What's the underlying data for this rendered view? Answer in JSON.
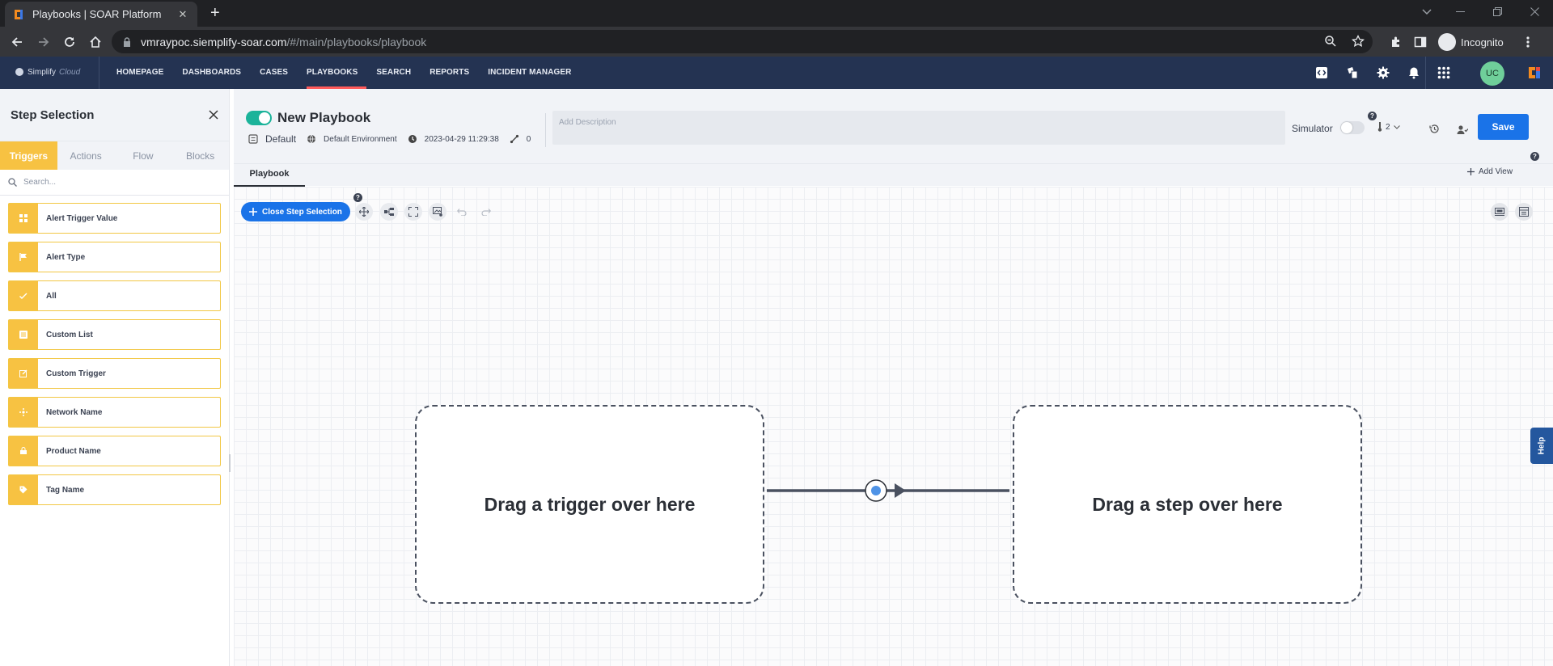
{
  "browser": {
    "tab_title": "Playbooks | SOAR Platform",
    "new_tab_icon": "plus-icon",
    "url_host": "vmraypoc.siemplify-soar.com",
    "url_path": "/#/main/playbooks/playbook",
    "profile_label": "Incognito"
  },
  "app": {
    "logo_text": "Simplify",
    "logo_suffix": "Cloud",
    "nav": [
      "HOMEPAGE",
      "DASHBOARDS",
      "CASES",
      "PLAYBOOKS",
      "SEARCH",
      "REPORTS",
      "INCIDENT MANAGER"
    ],
    "active_nav": "PLAYBOOKS",
    "accent_color": "#ff5b5b",
    "user_initials": "UC"
  },
  "step_selection": {
    "title": "Step Selection",
    "tabs": [
      "Triggers",
      "Actions",
      "Flow",
      "Blocks"
    ],
    "active_tab": "Triggers",
    "search_placeholder": "Search...",
    "triggers": [
      {
        "label": "Alert Trigger Value",
        "icon": "grid-icon"
      },
      {
        "label": "Alert Type",
        "icon": "flag-icon"
      },
      {
        "label": "All",
        "icon": "check-all-icon"
      },
      {
        "label": "Custom List",
        "icon": "list-icon"
      },
      {
        "label": "Custom Trigger",
        "icon": "edit-icon"
      },
      {
        "label": "Network Name",
        "icon": "network-icon"
      },
      {
        "label": "Product Name",
        "icon": "product-icon"
      },
      {
        "label": "Tag Name",
        "icon": "tag-icon"
      }
    ],
    "accent_color": "#f7c242"
  },
  "playbook": {
    "title": "New Playbook",
    "folder": "Default",
    "environment": "Default Environment",
    "timestamp": "2023-04-29 11:29:38",
    "steps_count": "0",
    "description_placeholder": "Add Description",
    "simulator_label": "Simulator",
    "priority": "2",
    "save_label": "Save",
    "tab": "Playbook",
    "add_view_label": "Add View",
    "help_mark": "?"
  },
  "canvas": {
    "close_step_label": "Close Step Selection",
    "trigger_zone_text": "Drag a trigger over here",
    "step_zone_text": "Drag a step over here",
    "help_tab": "Help"
  }
}
